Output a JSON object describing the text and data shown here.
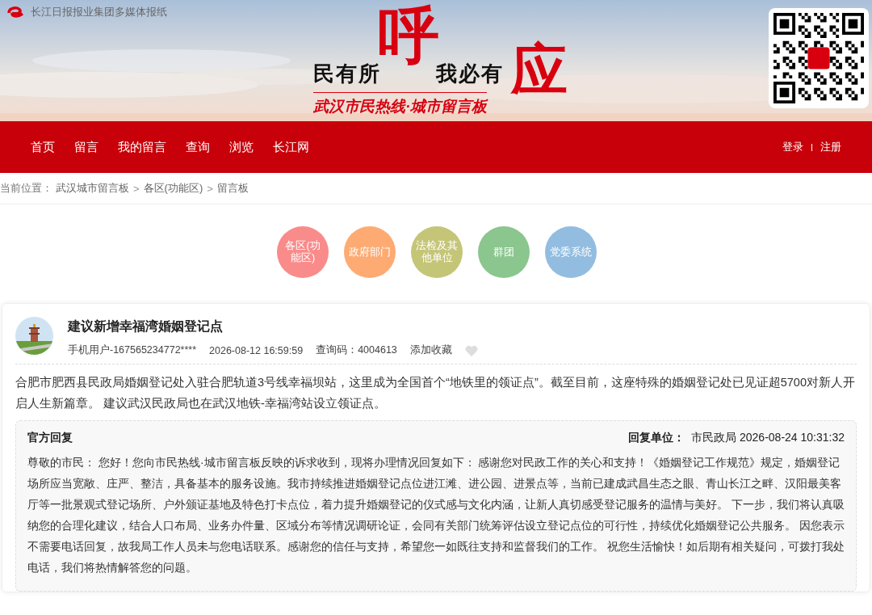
{
  "header": {
    "site_name": "长江日报报业集团多媒体报纸",
    "slogan": {
      "part_1": "民有所",
      "call": "呼",
      "part_2": "我必有",
      "answer": "应",
      "subtitle": "武汉市民热线·城市留言板"
    }
  },
  "nav": {
    "items": [
      {
        "label": "首页",
        "selected": false
      },
      {
        "label": "留言",
        "selected": false
      },
      {
        "label": "我的留言",
        "selected": false
      },
      {
        "label": "查询",
        "selected": false
      },
      {
        "label": "浏览",
        "selected": false
      },
      {
        "label": "长江网",
        "selected": false
      }
    ],
    "account": [
      "登录",
      "注册"
    ]
  },
  "breadcrumb": {
    "label": "当前位置：",
    "items": [
      {
        "kind": "link",
        "text": "武汉城市留言板"
      },
      {
        "kind": "separator",
        "text": ">"
      },
      {
        "kind": "link",
        "text": "各区(功能区)"
      },
      {
        "kind": "separator",
        "text": ">"
      },
      {
        "kind": "link",
        "text": "留言板"
      }
    ]
  },
  "categories": [
    {
      "label": "各区(功能区)",
      "color": "#f98b8b"
    },
    {
      "label": "政府部门",
      "color": "#fdab73"
    },
    {
      "label": "法检及其他单位",
      "color": "#c5c578"
    },
    {
      "label": "群团",
      "color": "#8ac68e"
    },
    {
      "label": "党委系统",
      "color": "#92bde0"
    }
  ],
  "message": {
    "title": "建议新增幸福湾婚姻登记点",
    "user": "手机用户-167565234772****",
    "time": "2026-08-12 16:59:59",
    "query_code": "查询码：4004613",
    "favorite": "添加收藏",
    "favorited": false,
    "body": "合肥市肥西县民政局婚姻登记处入驻合肥轨道3号线幸福坝站，这里成为全国首个“地铁里的领证点”。截至目前，这座特殊的婚姻登记处已见证超5700对新人开启人生新篇章。 建议武汉民政局也在武汉地铁-幸福湾站设立领证点。"
  },
  "reply": {
    "title": "官方回复",
    "unit_label": "回复单位：",
    "unit": "市民政局 2026-08-24 10:31:32",
    "body": "尊敬的市民： 您好！您向市民热线·城市留言板反映的诉求收到，现将办理情况回复如下： 感谢您对民政工作的关心和支持！《婚姻登记工作规范》规定，婚姻登记场所应当宽敞、庄严、整洁，具备基本的服务设施。我市持续推进婚姻登记点位进江滩、进公园、进景点等，当前已建成武昌生态之眼、青山长江之畔、汉阳最美客厅等一批景观式登记场所、户外颁证基地及特色打卡点位，着力提升婚姻登记的仪式感与文化内涵，让新人真切感受登记服务的温情与美好。 下一步，我们将认真吸纳您的合理化建议，结合人口布局、业务办件量、区域分布等情况调研论证，会同有关部门统筹评估设立登记点位的可行性，持续优化婚姻登记公共服务。 因您表示不需要电话回复，故我局工作人员未与您电话联系。感谢您的信任与支持，希望您一如既往支持和监督我们的工作。 祝您生活愉快！如后期有相关疑问，可拨打我处电话，我们将热情解答您的问题。"
  }
}
